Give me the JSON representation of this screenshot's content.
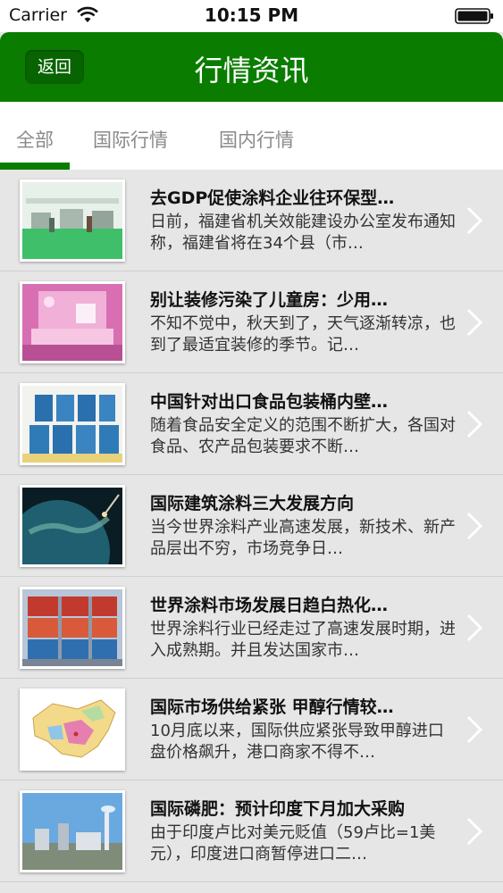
{
  "status_bar": {
    "carrier": "Carrier",
    "time": "10:15 PM"
  },
  "nav": {
    "back_label": "返回",
    "title": "行情资讯"
  },
  "tabs": [
    {
      "label": "全部"
    },
    {
      "label": "国际行情"
    },
    {
      "label": "国内行情"
    }
  ],
  "colors": {
    "brand_green": "#0a7d00",
    "list_background": "#e6e6e6"
  },
  "news": [
    {
      "title": "去GDP促使涂料企业往环保型…",
      "summary": "日前，福建省机关效能建设办公室发布通知称，福建省将在34个县（市…",
      "thumb": "factory-floor-photo"
    },
    {
      "title": "别让装修污染了儿童房：少用…",
      "summary": "不知不觉中，秋天到了，天气逐渐转凉，也到了最适宜装修的季节。记…",
      "thumb": "pink-kids-room-photo"
    },
    {
      "title": "中国针对出口食品包装桶内壁…",
      "summary": "随着食品安全定义的范围不断扩大，各国对食品、农产品包装要求不断…",
      "thumb": "paint-cans-photo"
    },
    {
      "title": "国际建筑涂料三大发展方向",
      "summary": "当今世界涂料产业高速发展，新技术、新产品层出不穷，市场竞争日…",
      "thumb": "earth-globe-photo"
    },
    {
      "title": "世界涂料市场发展日趋白热化…",
      "summary": "世界涂料行业已经走过了高速发展时期，进入成熟期。并且发达国家市…",
      "thumb": "paint-store-shelves-photo"
    },
    {
      "title": "国际市场供给紧张 甲醇行情较…",
      "summary": "10月底以来，国际供应紧张导致甲醇进口盘价格飙升，港口商家不得不…",
      "thumb": "china-map-photo"
    },
    {
      "title": "国际磷肥：预计印度下月加大采购",
      "summary": "由于印度卢比对美元贬值（59卢比=1美元），印度进口商暂停进口二…",
      "thumb": "industrial-plant-photo"
    }
  ]
}
